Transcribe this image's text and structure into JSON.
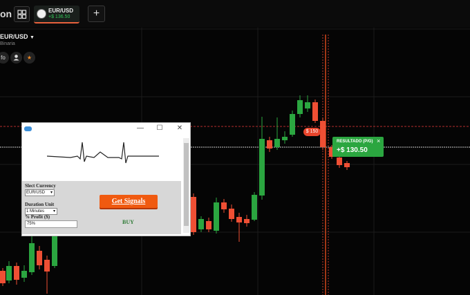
{
  "app": {
    "title_fragment": "on"
  },
  "tab": {
    "pair": "EUR/USD",
    "pnl": "+$ 136.50",
    "add_label": "+"
  },
  "asset": {
    "pair": "EUR/USD",
    "type": "Binaria",
    "info_label": "fo"
  },
  "trade": {
    "strike_bubble": "$ 150",
    "result_title": "RESULTADO (P/G)",
    "result_value": "+$ 130.50",
    "close_glyph": "×"
  },
  "popup": {
    "minimize": "—",
    "maximize": "☐",
    "close": "✕",
    "currency_label": "Slect Currency",
    "currency_value": "EUR/USD",
    "duration_label": "Duration Unit",
    "duration_value": "1 Minutes",
    "profit_label": "% Profit ($)",
    "profit_value": "75%",
    "signals_button": "Get Signals",
    "signal_result": "BUY"
  },
  "colors": {
    "bull": "#2ba640",
    "bear": "#ef4f34",
    "accent": "#f05a10"
  },
  "icons": [
    "grid-icon",
    "plus-icon",
    "flag-icon",
    "dropdown-caret-icon",
    "user-icon",
    "star-icon",
    "app-window-icon",
    "heartbeat-icon"
  ]
}
